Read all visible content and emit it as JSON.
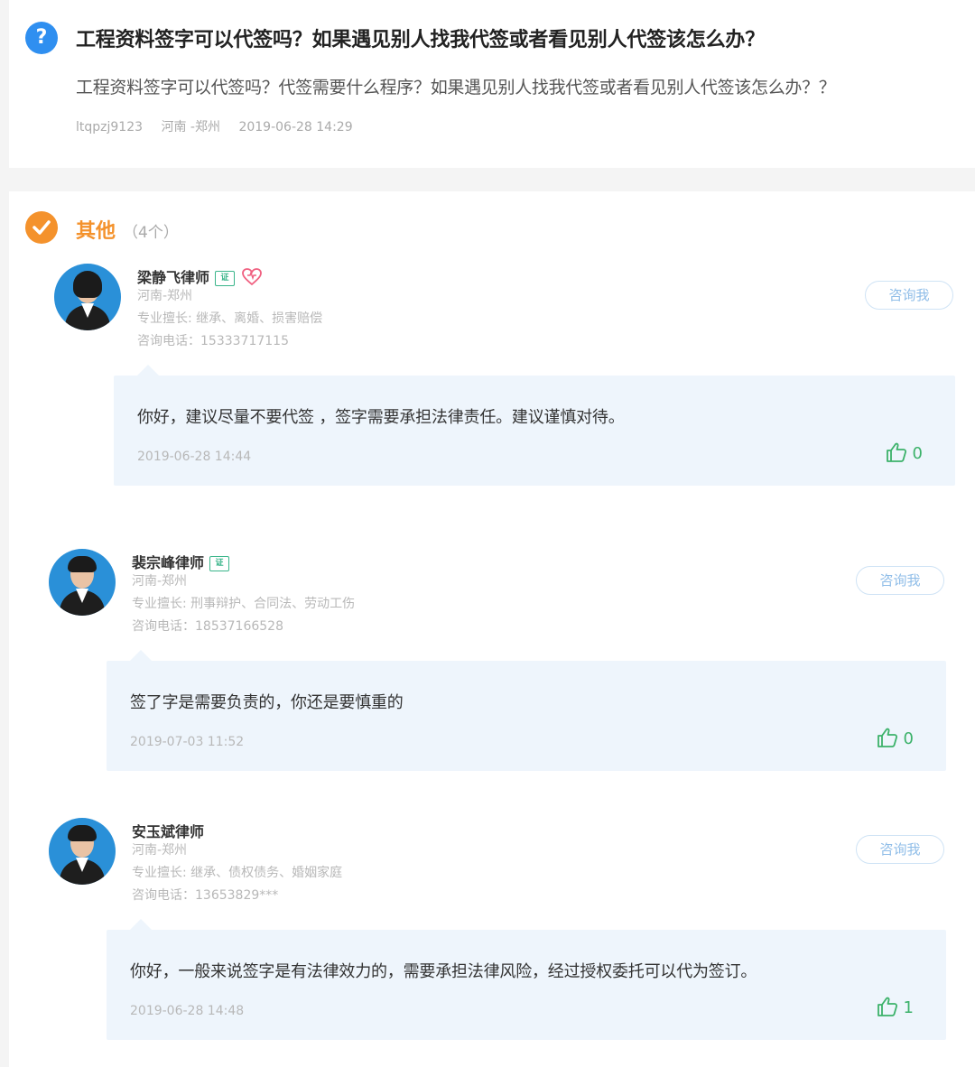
{
  "question": {
    "icon": "question-icon",
    "icon_glyph": "?",
    "title": "工程资料签字可以代签吗？如果遇见别人找我代签或者看见别人代签该怎么办？",
    "description": "工程资料签字可以代签吗？代签需要什么程序？如果遇见别人找我代签或者看见别人代签该怎么办？？",
    "user": "ltqpzj9123",
    "location": "河南 -郑州",
    "time": "2019-06-28 14:29"
  },
  "answers_section": {
    "title": "其他",
    "count": "（4个）"
  },
  "answers": [
    {
      "name": "梁静飞律师",
      "badge": "证",
      "location": "河南-郑州",
      "specialty": "专业擅长: 继承、离婚、损害赔偿",
      "phone": "咨询电话：15333717115",
      "consult_label": "咨询我",
      "answer": "你好，建议尽量不要代签 ，签字需要承担法律责任。建议谨慎对待。",
      "time": "2019-06-28 14:44",
      "likes": "0"
    },
    {
      "name": "裴宗峰律师",
      "badge": "证",
      "location": "河南-郑州",
      "specialty": "专业擅长: 刑事辩护、合同法、劳动工伤",
      "phone": "咨询电话：18537166528",
      "consult_label": "咨询我",
      "answer": "签了字是需要负责的，你还是要慎重的",
      "time": "2019-07-03 11:52",
      "likes": "0"
    },
    {
      "name": "安玉斌律师",
      "location": "河南-郑州",
      "specialty": "专业擅长: 继承、债权债务、婚姻家庭",
      "phone": "咨询电话：13653829***",
      "consult_label": "咨询我",
      "answer": "你好，一般来说签字是有法律效力的，需要承担法律风险，经过授权委托可以代为签订。",
      "time": "2019-06-28 14:48",
      "likes": "1"
    }
  ],
  "colors": {
    "accent_blue": "#2f8ff0",
    "accent_orange": "#f4922c",
    "like_green": "#3cb26a",
    "bubble_bg": "#eef5fc"
  }
}
